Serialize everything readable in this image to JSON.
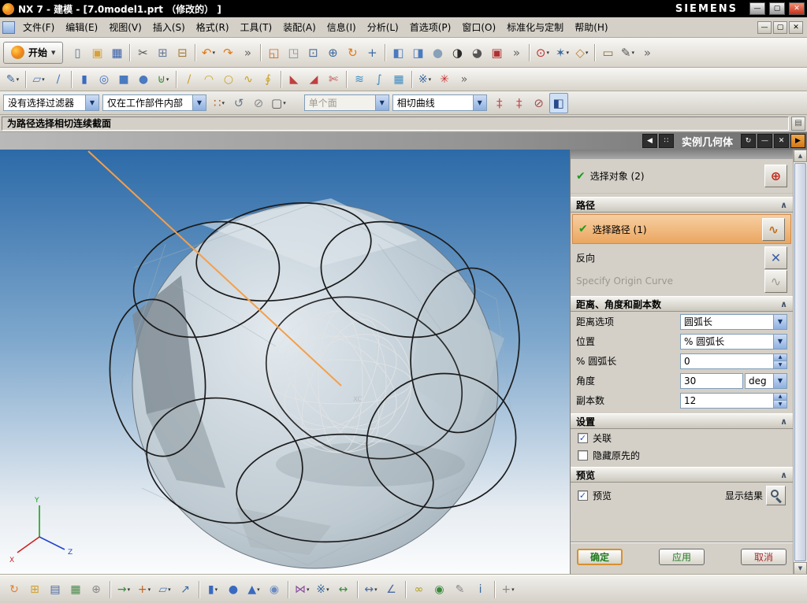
{
  "window": {
    "title": "NX 7 - 建模 - [7.0model1.prt （修改的） ]",
    "brand": "SIEMENS"
  },
  "glyphs": {
    "minimize": "—",
    "maximize": "▢",
    "close": "✕",
    "check": "✔",
    "chevron": "∧",
    "combo_arrow": "▼",
    "spin_up": "▲",
    "spin_down": "▼",
    "scroll_up": "▲",
    "scroll_down": "▼",
    "back": "◀",
    "forward": "▶",
    "reset": "↻",
    "rail": "∷",
    "crosshair": "⊕",
    "curve": "∿",
    "reverse": "✕",
    "origin_curve": "∿",
    "grip": "◢",
    "prompt_button": "▤",
    "check_small": "✓"
  },
  "menubar": {
    "items": [
      "文件(F)",
      "编辑(E)",
      "视图(V)",
      "插入(S)",
      "格式(R)",
      "工具(T)",
      "装配(A)",
      "信息(I)",
      "分析(L)",
      "首选项(P)",
      "窗口(O)",
      "标准化与定制",
      "帮助(H)"
    ]
  },
  "toolbar_top": {
    "start_label": "开始",
    "icons": [
      {
        "n": "new-file-icon",
        "g": "▯",
        "c": "#607a9a"
      },
      {
        "n": "open-folder-icon",
        "g": "▣",
        "c": "#d7a23b"
      },
      {
        "n": "save-icon",
        "g": "▦",
        "c": "#3a5fa8"
      },
      {
        "sep": true
      },
      {
        "n": "cut-icon",
        "g": "✂",
        "c": "#555555"
      },
      {
        "n": "copy-icon",
        "g": "⊞",
        "c": "#6a7a9a"
      },
      {
        "n": "paste-icon",
        "g": "⊟",
        "c": "#a67c3a"
      },
      {
        "sep": true
      },
      {
        "n": "undo-icon",
        "g": "↶",
        "c": "#e07818",
        "d": true
      },
      {
        "n": "redo-icon",
        "g": "↷",
        "c": "#e07818"
      },
      {
        "n": "toolbar-overflow-icon",
        "g": "»",
        "c": "#666666"
      },
      {
        "sep": true
      },
      {
        "n": "window-layout-icon",
        "g": "◱",
        "c": "#d06820"
      },
      {
        "n": "window-cascade-icon",
        "g": "◳",
        "c": "#8090a0"
      },
      {
        "n": "zoom-area-icon",
        "g": "⊡",
        "c": "#4a6a9a"
      },
      {
        "n": "zoom-in-out-icon",
        "g": "⊕",
        "c": "#3a6aa0"
      },
      {
        "n": "rotate-view-icon",
        "g": "↻",
        "c": "#e07818"
      },
      {
        "n": "pan-view-icon",
        "g": "+",
        "c": "#3a6aa0"
      },
      {
        "sep": true
      },
      {
        "n": "isometric-view-icon",
        "g": "◧",
        "c": "#4a7ac0"
      },
      {
        "n": "trimetric-view-icon",
        "g": "◨",
        "c": "#4a7ac0"
      },
      {
        "n": "shaded-view-icon",
        "g": "●",
        "c": "#88a0b8"
      },
      {
        "n": "wireframe-view-icon",
        "g": "◑",
        "c": "#2a2a2a"
      },
      {
        "n": "render-style-icon",
        "g": "◕",
        "c": "#555555"
      },
      {
        "n": "front-view-icon",
        "g": "▣",
        "c": "#b03030"
      },
      {
        "n": "toolbar-overflow-icon",
        "g": "»",
        "c": "#666666"
      },
      {
        "sep": true
      },
      {
        "n": "snap-point-icon",
        "g": "⊙",
        "c": "#c03030",
        "d": true
      },
      {
        "n": "orient-view-icon",
        "g": "✶",
        "c": "#3a6aa0",
        "d": true
      },
      {
        "n": "datum-display-icon",
        "g": "◇",
        "c": "#c08030",
        "d": true
      },
      {
        "sep": true
      },
      {
        "n": "measure-icon",
        "g": "▭",
        "c": "#8a6a3a"
      },
      {
        "n": "annotate-icon",
        "g": "✎",
        "c": "#555555",
        "d": true
      },
      {
        "n": "toolbar-overflow-icon",
        "g": "»",
        "c": "#666666"
      }
    ]
  },
  "toolbar_second": {
    "icons": [
      {
        "n": "sketch-icon",
        "g": "✎",
        "c": "#3a6aa0",
        "d": true
      },
      {
        "sep": true
      },
      {
        "n": "datum-plane-icon",
        "g": "▱",
        "c": "#4a7ac0",
        "d": true
      },
      {
        "n": "datum-axis-icon",
        "g": "/",
        "c": "#4a7ac0"
      },
      {
        "sep": true
      },
      {
        "n": "extrude-icon",
        "g": "▮",
        "c": "#3a6ac0"
      },
      {
        "n": "revolve-icon",
        "g": "◎",
        "c": "#3a6ac0"
      },
      {
        "n": "block-icon",
        "g": "■",
        "c": "#4a7ac0"
      },
      {
        "n": "cylinder-icon",
        "g": "●",
        "c": "#4a7ac0"
      },
      {
        "n": "unite-icon",
        "g": "⊎",
        "c": "#3a8a3a",
        "d": true
      },
      {
        "sep": true
      },
      {
        "n": "line-icon",
        "g": "/",
        "c": "#c8a020"
      },
      {
        "n": "arc-icon",
        "g": "◠",
        "c": "#c8a020"
      },
      {
        "n": "circle-icon",
        "g": "○",
        "c": "#c8a020"
      },
      {
        "n": "spline-icon",
        "g": "∿",
        "c": "#c8a020"
      },
      {
        "n": "helix-icon",
        "g": "∮",
        "c": "#c8a020"
      },
      {
        "sep": true
      },
      {
        "n": "edge-blend-icon",
        "g": "◣",
        "c": "#c04040"
      },
      {
        "n": "chamfer-icon",
        "g": "◢",
        "c": "#c04040"
      },
      {
        "n": "trim-body-icon",
        "g": "✄",
        "c": "#c04040"
      },
      {
        "sep": true
      },
      {
        "n": "through-curves-icon",
        "g": "≋",
        "c": "#3a8ac0"
      },
      {
        "n": "swept-icon",
        "g": "∫",
        "c": "#3a8ac0"
      },
      {
        "n": "mesh-surface-icon",
        "g": "▦",
        "c": "#3a8ac0"
      },
      {
        "sep": true
      },
      {
        "n": "instance-feature-icon",
        "g": "※",
        "c": "#3a6aa0",
        "d": true
      },
      {
        "n": "synchronous-icon",
        "g": "✳",
        "c": "#c03030"
      },
      {
        "n": "toolbar-overflow-icon",
        "g": "»",
        "c": "#666666"
      }
    ]
  },
  "filter_bar": {
    "selection_filter": "没有选择过滤器",
    "scope": "仅在工作部件内部",
    "face_rule": "单个面",
    "curve_rule": "相切曲线",
    "left_icons": [
      {
        "n": "snap-paw-icon",
        "g": "∷",
        "c": "#c06020",
        "d": true
      },
      {
        "n": "selection-mode-icon",
        "g": "↺",
        "c": "#6a7a8a"
      },
      {
        "n": "highlight-icon",
        "g": "⊘",
        "c": "#8a8a8a"
      },
      {
        "n": "lasso-icon",
        "g": "▢",
        "c": "#555555",
        "d": true
      }
    ],
    "right_icons": [
      {
        "n": "stop-short-icon",
        "g": "‡",
        "c": "#c05050"
      },
      {
        "n": "follow-fillet-icon",
        "g": "‡",
        "c": "#c05050"
      },
      {
        "n": "no-selection-icon",
        "g": "⊘",
        "c": "#a05050"
      },
      {
        "n": "shaded-cube-icon",
        "g": "◧",
        "c": "#2a4a8a",
        "b": "#cfe0f4"
      }
    ]
  },
  "prompt_bar": {
    "text": "为路径选择相切连续截面"
  },
  "dialog_bar": {
    "title": "实例几何体"
  },
  "viewport": {
    "wcs_label": "XC",
    "axis_x": "X",
    "axis_y": "Y",
    "axis_z": "Z"
  },
  "dialog": {
    "select_object_label": "选择对象 (2)",
    "path_header": "路径",
    "select_path_label": "选择路径 (1)",
    "reverse_label": "反向",
    "origin_curve_label": "Specify Origin Curve",
    "dist_header": "距离、角度和副本数",
    "rows": [
      {
        "label": "距离选项",
        "value": "圆弧长"
      },
      {
        "label": "位置",
        "value": "% 圆弧长"
      },
      {
        "label": "% 圆弧长",
        "value": "0"
      },
      {
        "label": "角度",
        "value": "30",
        "unit": "deg"
      },
      {
        "label": "副本数",
        "value": "12"
      }
    ],
    "settings_header": "设置",
    "associative_label": "关联",
    "hide_original_label": "隐藏原先的",
    "preview_header": "预览",
    "preview_label": "预览",
    "show_result_label": "显示结果",
    "ok": "确定",
    "apply": "应用",
    "cancel": "取消"
  },
  "bottom_toolbar": {
    "icons": [
      {
        "n": "refresh-icon",
        "g": "↻",
        "c": "#e08030"
      },
      {
        "n": "fit-view-icon",
        "g": "⊞",
        "c": "#d0a030"
      },
      {
        "n": "layer-icon",
        "g": "▤",
        "c": "#4a6aa0"
      },
      {
        "n": "grid-icon",
        "g": "▦",
        "c": "#4a8a4a"
      },
      {
        "n": "wcs-dynamics-icon",
        "g": "⊕",
        "c": "#888888"
      },
      {
        "sep": true
      },
      {
        "n": "move-object-icon",
        "g": "→",
        "c": "#3a8a3a",
        "d": true
      },
      {
        "n": "point-constructor-icon",
        "g": "+",
        "c": "#c06020",
        "d": true
      },
      {
        "n": "plane-icon",
        "g": "▱",
        "c": "#4a7ac0",
        "d": true
      },
      {
        "n": "vector-icon",
        "g": "↗",
        "c": "#3a6aa0"
      },
      {
        "sep": true
      },
      {
        "n": "extrude-icon",
        "g": "▮",
        "c": "#3a6ac0",
        "d": true
      },
      {
        "n": "cylinder-icon",
        "g": "●",
        "c": "#3a6ac0"
      },
      {
        "n": "cone-icon",
        "g": "▲",
        "c": "#3a6ac0",
        "d": true
      },
      {
        "n": "sphere-icon",
        "g": "◉",
        "c": "#6a8ac0"
      },
      {
        "sep": true
      },
      {
        "n": "mirror-icon",
        "g": "⋈",
        "c": "#8a4aa0",
        "d": true
      },
      {
        "n": "pattern-icon",
        "g": "※",
        "c": "#3a6aa0",
        "d": true
      },
      {
        "n": "scale-icon",
        "g": "↔",
        "c": "#3a8a3a"
      },
      {
        "sep": true
      },
      {
        "n": "measure-distance-icon",
        "g": "↔",
        "c": "#4a6aa0",
        "d": true
      },
      {
        "n": "measure-angle-icon",
        "g": "∠",
        "c": "#4a6aa0"
      },
      {
        "sep": true
      },
      {
        "n": "link-icon",
        "g": "∞",
        "c": "#b0a020"
      },
      {
        "n": "constraint-icon",
        "g": "◉",
        "c": "#3a8a3a"
      },
      {
        "n": "note-icon",
        "g": "✎",
        "c": "#888888"
      },
      {
        "n": "info-icon",
        "g": "i",
        "c": "#3a6aa0"
      },
      {
        "sep": true
      },
      {
        "n": "customize-icon",
        "g": "+",
        "c": "#888888",
        "d": true
      }
    ]
  }
}
